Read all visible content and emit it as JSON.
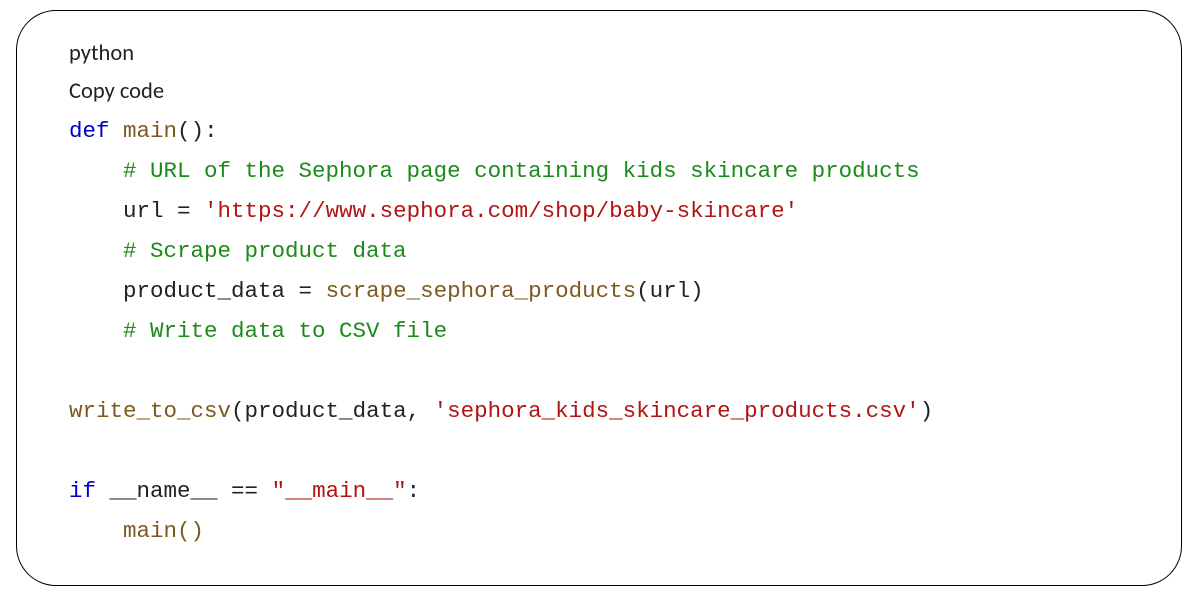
{
  "header": {
    "lang": "python",
    "copy": "Copy code"
  },
  "code": {
    "kw_def": "def",
    "fn_main": "main",
    "paren_open": "(",
    "paren_close": ")",
    "colon": ":",
    "comment_url": "# URL of the Sephora page containing kids skincare products",
    "var_url": "url",
    "eq": " = ",
    "str_url": "'https://www.sephora.com/shop/baby-skincare'",
    "comment_scrape": "# Scrape product data",
    "var_pd": "product_data",
    "fn_scrape": "scrape_sephora_products",
    "arg_url": "url",
    "comment_csv": "# Write data to CSV file",
    "fn_write": "write_to_csv",
    "arg_pd": "product_data",
    "comma_sp": ", ",
    "str_csv": "'sephora_kids_skincare_products.csv'",
    "kw_if": "if",
    "dunder_name": " __name__ ",
    "op_eq": "==",
    "sp": " ",
    "str_mainq1": "\"__",
    "str_main_mid": "main",
    "str_mainq2": "__\"",
    "main_call": "main()"
  }
}
